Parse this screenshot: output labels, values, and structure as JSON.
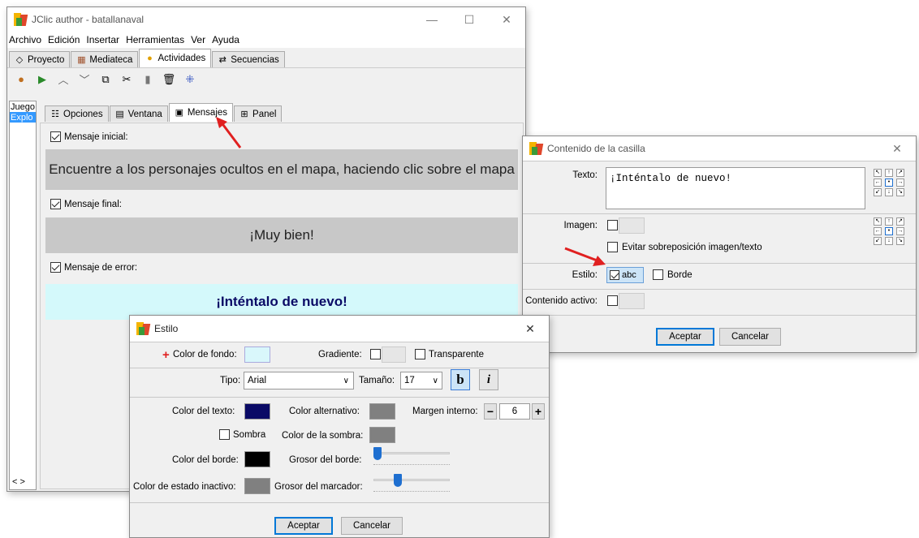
{
  "main": {
    "title": "JClic author - batallanaval",
    "menu": [
      "Archivo",
      "Edición",
      "Insertar",
      "Herramientas",
      "Ver",
      "Ayuda"
    ],
    "menu_underline": [
      "A",
      "E",
      "I",
      "H",
      "V",
      "y"
    ],
    "tabs": [
      "Proyecto",
      "Mediateca",
      "Actividades",
      "Secuencias"
    ],
    "list_items": [
      "Juego",
      "Explo"
    ],
    "sub_tabs": [
      "Opciones",
      "Ventana",
      "Mensajes",
      "Panel"
    ],
    "msg_initial_label": "Mensaje inicial:",
    "msg_initial_text": "Encuentre a los personajes ocultos en el mapa, haciendo clic sobre el mapa",
    "msg_final_label": "Mensaje final:",
    "msg_final_text": "¡Muy bien!",
    "msg_error_label": "Mensaje de error:",
    "msg_error_text": "¡Inténtalo de nuevo!",
    "scroll_arrows": "< >"
  },
  "cell": {
    "title": "Contenido de la casilla",
    "texto_label": "Texto:",
    "texto_value": "¡Inténtalo de nuevo!",
    "imagen_label": "Imagen:",
    "avoid_overlap_label": "Evitar sobreposición imagen/texto",
    "estilo_label": "Estilo:",
    "estilo_sample": "abc",
    "borde_label": "Borde",
    "contenido_activo_label": "Contenido activo:",
    "ok": "Aceptar",
    "cancel": "Cancelar"
  },
  "style": {
    "title": "Estilo",
    "bg_color_label": "Color de fondo:",
    "gradient_label": "Gradiente:",
    "transparent_label": "Transparente",
    "font_label": "Tipo:",
    "font_value": "Arial",
    "size_label": "Tamaño:",
    "size_value": "17",
    "bold_label": "b",
    "italic_label": "i",
    "text_color_label": "Color del texto:",
    "alt_color_label": "Color alternativo:",
    "margin_label": "Margen interno:",
    "margin_value": "6",
    "minus": "−",
    "plus": "+",
    "shadow_label": "Sombra",
    "shadow_color_label": "Color de la sombra:",
    "border_color_label": "Color del borde:",
    "border_width_label": "Grosor del borde:",
    "inactive_color_label": "Color de estado inactivo:",
    "marker_width_label": "Grosor del marcador:",
    "ok": "Aceptar",
    "cancel": "Cancelar",
    "border_width_level": 0.0,
    "marker_width_level": 0.3
  },
  "colors": {
    "bg_color": "#d9f7fb",
    "text_color": "#0a0a66",
    "alt_color": "#808080",
    "shadow_color": "#808080",
    "border_color": "#000000",
    "inactive_color": "#808080",
    "msg_gray": "#c8c8c8",
    "msg_error_bg": "#d4f9fb",
    "accent_red": "#e02020"
  }
}
